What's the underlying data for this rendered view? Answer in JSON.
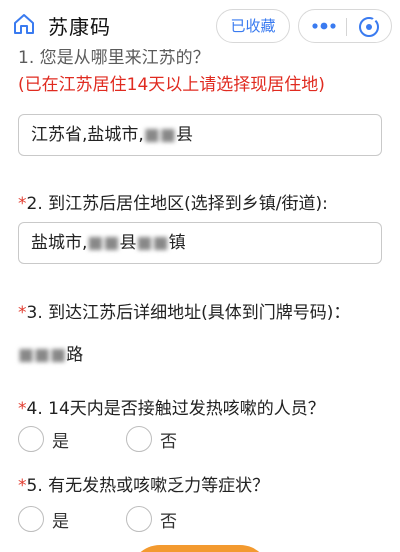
{
  "app": {
    "title": "苏康码",
    "collect_label": "已收藏"
  },
  "icons": {
    "home": "home-icon",
    "more": "more-icon",
    "close": "close-icon"
  },
  "colors": {
    "accent": "#3a7bf0",
    "required": "#e23b2e",
    "note": "#e02b20"
  },
  "questions": [
    {
      "title": "1. 您是从哪里来江苏的？",
      "note": "(已在江苏居住14天以上请选择现居住地)",
      "value_prefix": "江苏省,盐城市,",
      "value_blur": "■■",
      "value_suffix": "县"
    },
    {
      "star": "*",
      "title": "2. 到江苏后居住地区(选择到乡镇/街道):",
      "value_prefix": "盐城市,",
      "value_blur1": "■■",
      "value_mid": "县",
      "value_blur2": "■■",
      "value_suffix": "镇"
    },
    {
      "star": "*",
      "title": "3. 到达江苏后详细地址(具体到门牌号码)：",
      "value_blur": "■■■",
      "value_suffix": "路"
    },
    {
      "star": "*",
      "title": "4. 14天内是否接触过发热咳嗽的人员？",
      "options": [
        "是",
        "否"
      ]
    },
    {
      "star": "*",
      "title": "5. 有无发热或咳嗽乏力等症状？",
      "options": [
        "是",
        "否"
      ]
    }
  ]
}
